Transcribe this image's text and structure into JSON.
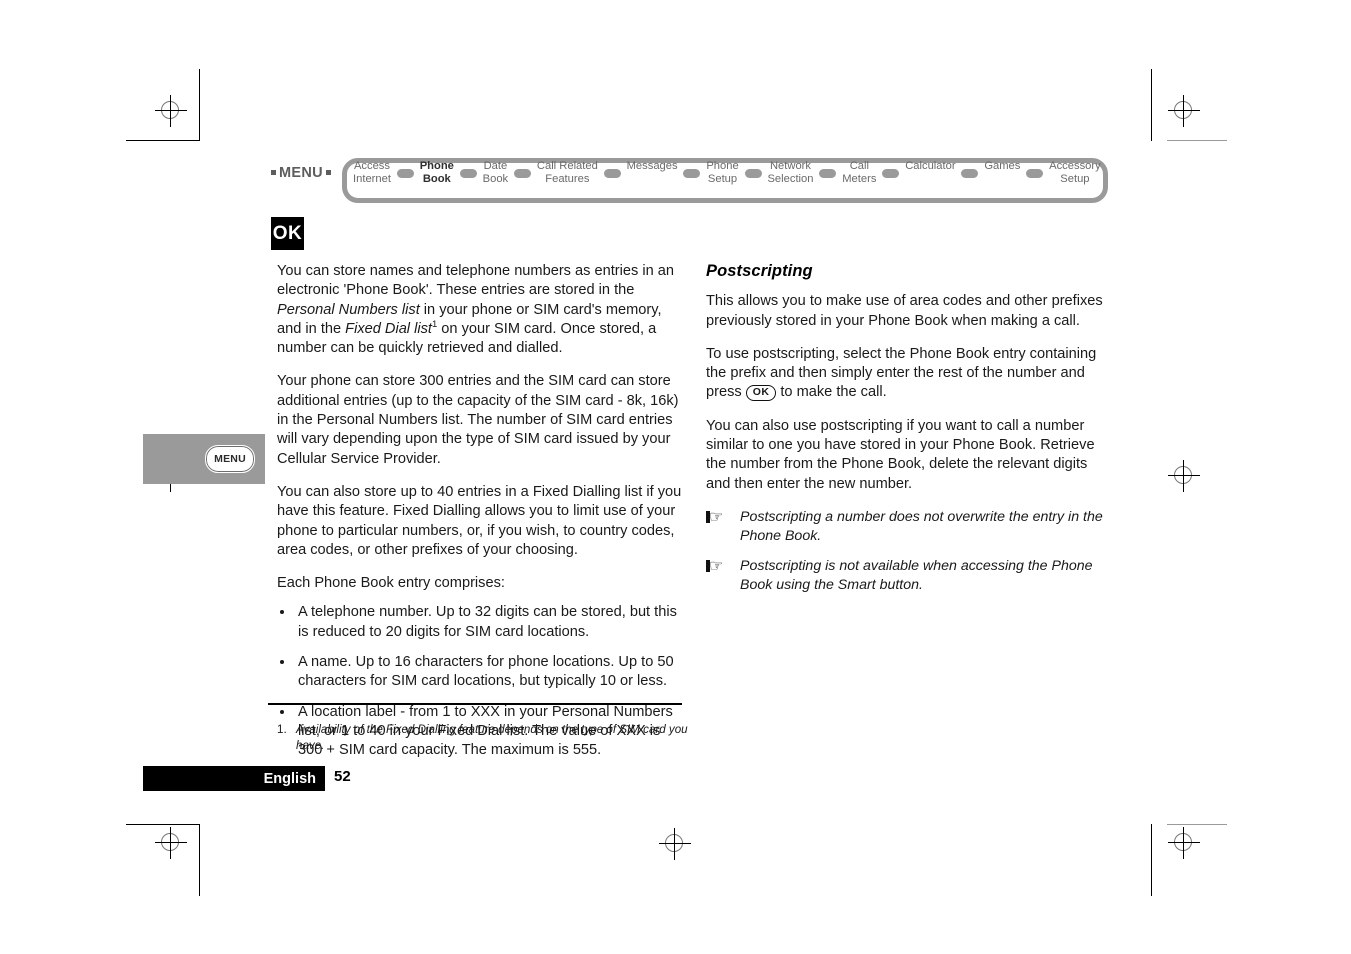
{
  "nav": {
    "menu_label": "MENU",
    "items": [
      {
        "label": "Access\nInternet",
        "current": false
      },
      {
        "label": "Phone\nBook",
        "current": true
      },
      {
        "label": "Date\nBook",
        "current": false
      },
      {
        "label": "Call Related\nFeatures",
        "current": false
      },
      {
        "label": "Messages",
        "current": false
      },
      {
        "label": "Phone\nSetup",
        "current": false
      },
      {
        "label": "Network\nSelection",
        "current": false
      },
      {
        "label": "Call\nMeters",
        "current": false
      },
      {
        "label": "Calculator",
        "current": false
      },
      {
        "label": "Games",
        "current": false
      },
      {
        "label": "Accessory\nSetup",
        "current": false
      }
    ]
  },
  "margin_tab": {
    "label": "MENU"
  },
  "ok_badge": {
    "label": "OK"
  },
  "left_column": {
    "paragraphs": [
      {
        "runs": [
          {
            "text": "You can store names and telephone numbers as entries in an electronic 'Phone Book'. These entries are stored in the ",
            "style": "normal"
          },
          {
            "text": "Personal Numbers list",
            "style": "italic"
          },
          {
            "text": " in your phone or SIM card's memory, and in the ",
            "style": "normal"
          },
          {
            "text": "Fixed Dial list",
            "style": "italic"
          },
          {
            "text": "1",
            "style": "superscript"
          },
          {
            "text": " on your SIM card. Once stored, a number can be quickly retrieved and dialled.",
            "style": "normal"
          }
        ]
      },
      {
        "runs": [
          {
            "text": "Your phone can store 300 entries and the SIM card can store additional entries (up to the capacity of the SIM card - 8k, 16k) in the Personal Numbers list. The number of SIM card entries will vary depending upon the type of SIM card issued by your Cellular Service Provider.",
            "style": "normal"
          }
        ]
      },
      {
        "runs": [
          {
            "text": "You can also store up to 40 entries in a Fixed Dialling list if you have this feature. Fixed Dialling allows you to limit use of your phone to particular numbers, or, if you wish, to country codes, area codes, or other prefixes of your choosing.",
            "style": "normal"
          }
        ]
      },
      {
        "runs": [
          {
            "text": "Each Phone Book entry comprises:",
            "style": "normal"
          }
        ]
      }
    ],
    "bullets": [
      "A telephone number. Up to 32 digits can be stored, but this is reduced to 20 digits for SIM card locations.",
      "A name. Up to 16 characters for phone locations. Up to 50 characters for SIM card locations, but typically 10 or less.",
      "A location label - from 1 to XXX in your Personal Numbers list, or 1 to 40 in your Fixed Dial list. The value of XXX is 300 + SIM card capacity. The maximum is 555."
    ]
  },
  "footnote": {
    "number": "1.",
    "text": "Availability of the Fixed Dialling feature depends on the type of SIM card you have."
  },
  "right_column": {
    "title": "Postscripting",
    "paragraph_1": "This allows you to make use of area codes and other prefixes previously stored in your Phone Book when making a call.",
    "paragraph_2_before_key": "To use postscripting, select the Phone Book entry containing the prefix and then simply enter the rest of the number and press ",
    "inline_key_label": "OK",
    "paragraph_2_after_key": " to make the call.",
    "paragraph_3": "You can also use postscripting if you want to call a number similar to one you have stored in your Phone Book. Retrieve the number from the Phone Book, delete the relevant digits and then enter the new number.",
    "notes": [
      "Postscripting a number does not overwrite the entry in the Phone Book.",
      "Postscripting is not available when accessing the Phone Book using the Smart button."
    ]
  },
  "footer": {
    "language": "English",
    "page_number": "52"
  }
}
